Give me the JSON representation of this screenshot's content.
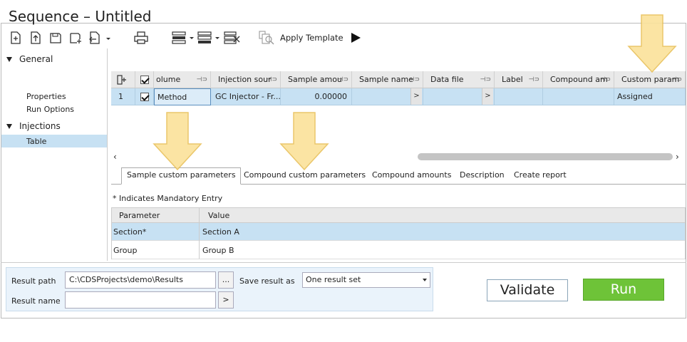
{
  "window": {
    "title": "Sequence – Untitled"
  },
  "toolbar": {
    "apply_template_label": "Apply Template",
    "icons": [
      "new-sequence-icon",
      "import-icon",
      "save-icon",
      "save-as-icon",
      "export-icon",
      "print-icon",
      "insert-row-icon",
      "append-row-icon",
      "delete-row-icon",
      "apply-template-icon",
      "play-icon"
    ]
  },
  "tree": {
    "groups": [
      {
        "label": "General",
        "items": [
          "Properties",
          "Run Options"
        ]
      },
      {
        "label": "Injections",
        "items": [
          "Table"
        ]
      }
    ],
    "selected": "Table"
  },
  "grid": {
    "columns": [
      "olume",
      "Injection sour",
      "Sample amou",
      "Sample name",
      "Data file",
      "Label",
      "Compound am",
      "Custom param"
    ],
    "rows": [
      {
        "num": "1",
        "volume": "Method",
        "source": "GC Injector - Fr...",
        "amount": "0.00000",
        "name": "",
        "data_file": "",
        "label": "",
        "compound": "",
        "custom": "Assigned"
      }
    ]
  },
  "tabs": [
    "Sample custom parameters",
    "Compound custom parameters",
    "Compound amounts",
    "Description",
    "Create report"
  ],
  "active_tab": "Sample custom parameters",
  "mandatory_note": "* Indicates Mandatory Entry",
  "params": {
    "headers": {
      "parameter": "Parameter",
      "value": "Value"
    },
    "rows": [
      {
        "parameter": "Section*",
        "value": "Section A"
      },
      {
        "parameter": "Group",
        "value": "Group B"
      }
    ]
  },
  "result": {
    "path_label": "Result path",
    "path_value": "C:\\CDSProjects\\demo\\Results",
    "name_label": "Result name",
    "name_value": "",
    "save_as_label": "Save result as",
    "save_as_value": "One result set",
    "browse_label": "...",
    "name_btn_label": ">"
  },
  "buttons": {
    "validate": "Validate",
    "run": "Run"
  },
  "colors": {
    "selection": "#c7e1f3",
    "run_green": "#6ec338",
    "arrow_fill": "#fbe29a",
    "arrow_stroke": "#e8c05a"
  }
}
